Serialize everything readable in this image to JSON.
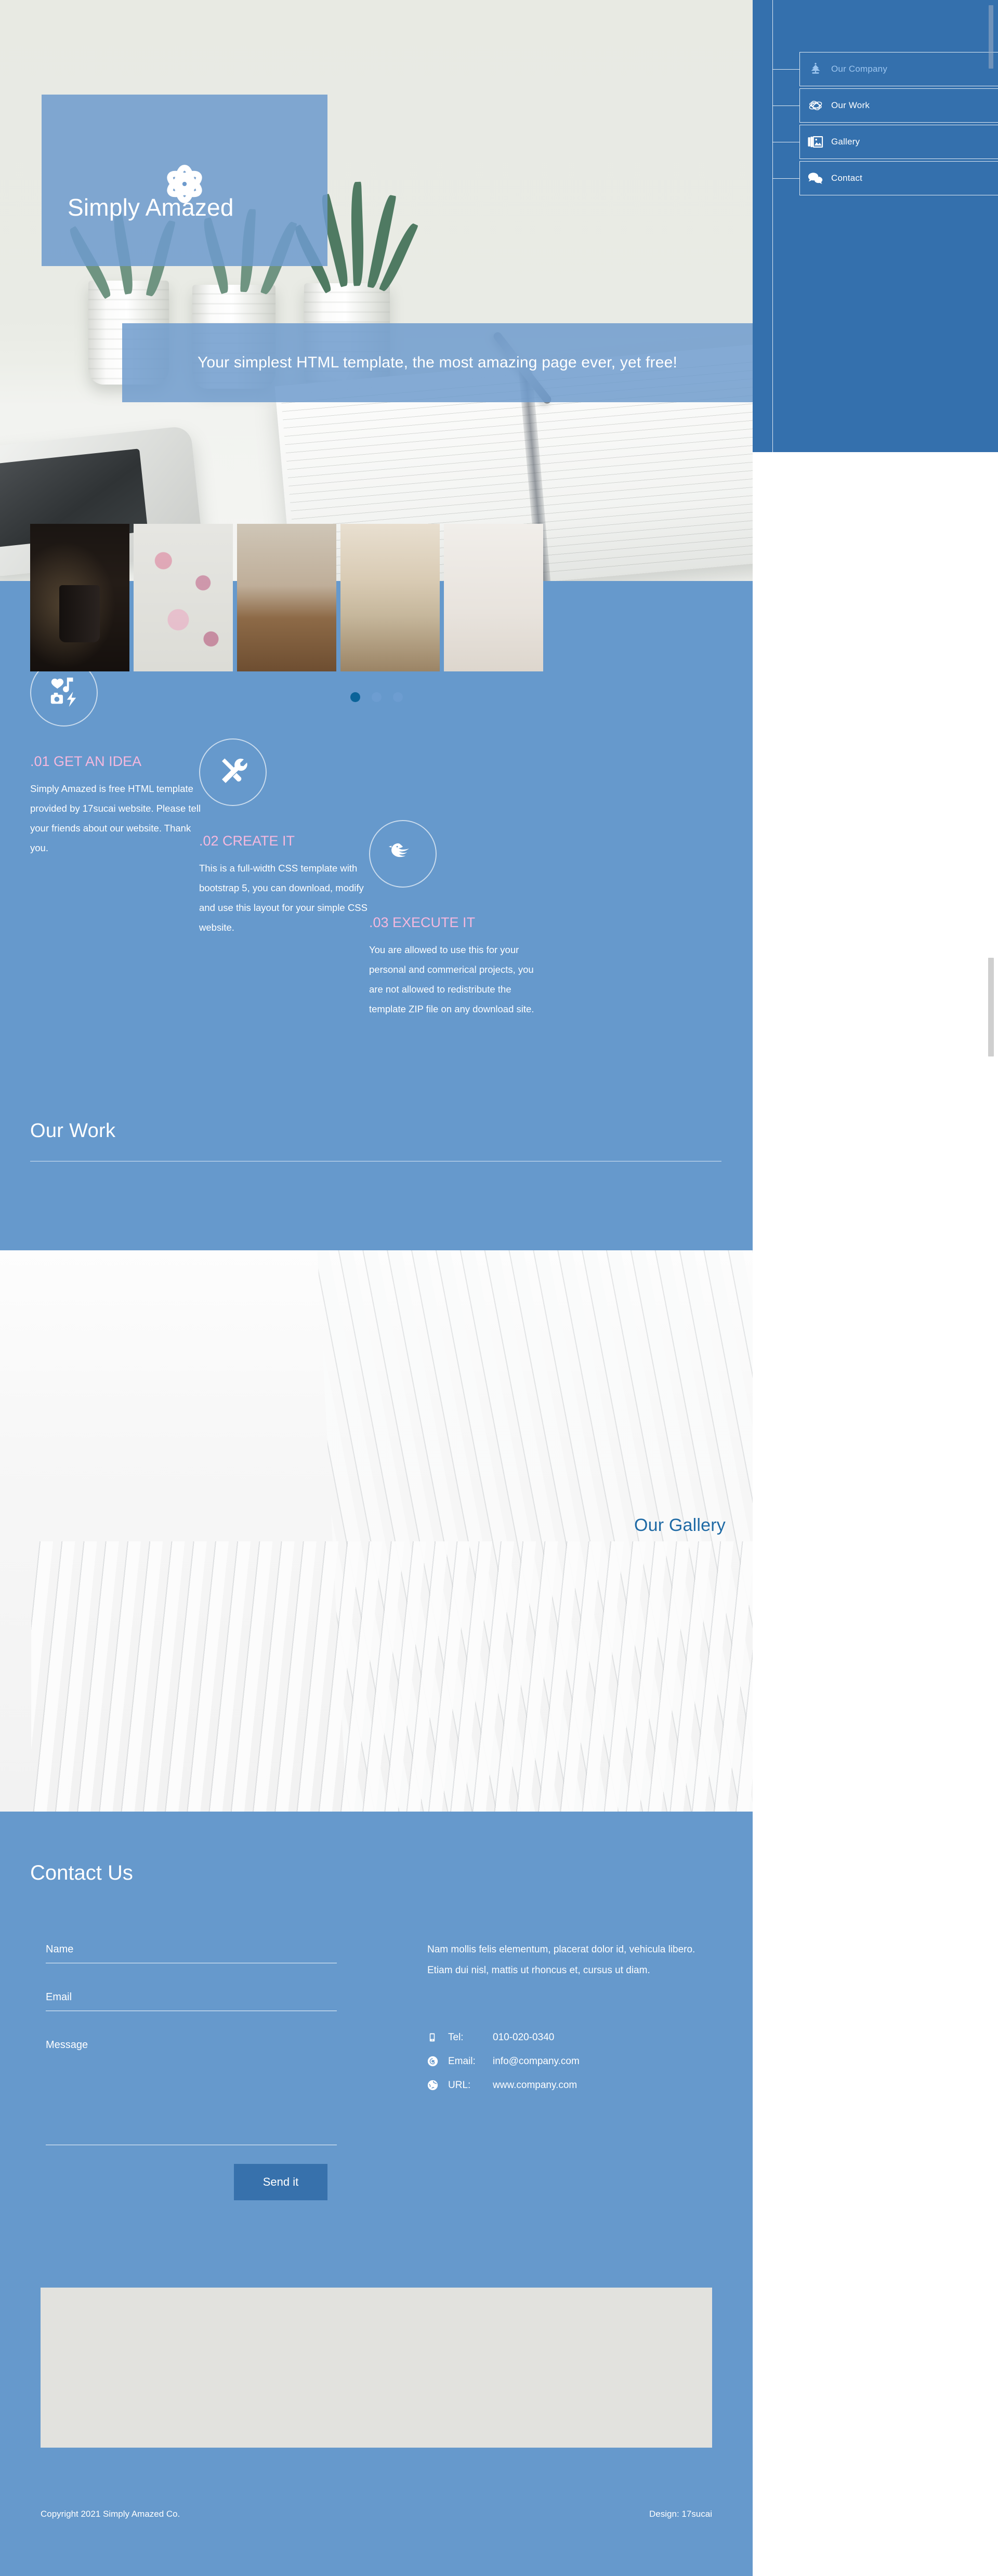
{
  "site": {
    "brand": "Simply Amazed",
    "tagline": "Your simplest HTML template, the most amazing page ever, yet free!"
  },
  "nav": {
    "items": [
      {
        "label": "Our Company",
        "icon": "company-tree-icon",
        "active": true
      },
      {
        "label": "Our Work",
        "icon": "orbit-icon",
        "active": false
      },
      {
        "label": "Gallery",
        "icon": "images-icon",
        "active": false
      },
      {
        "label": "Contact",
        "icon": "chat-bubbles-icon",
        "active": false
      }
    ]
  },
  "features": {
    "items": [
      {
        "title": ".01 GET AN IDEA",
        "icon": "media-mix-icon",
        "text": "Simply Amazed is free HTML template provided by 17sucai website. Please tell your friends about our website. Thank you."
      },
      {
        "title": ".02 CREATE IT",
        "icon": "tools-icon",
        "text": "This is a full-width CSS template with bootstrap 5, you can download, modify and use this layout for your simple CSS website."
      },
      {
        "title": ".03 EXECUTE IT",
        "icon": "bird-icon",
        "text": "You are allowed to use this for your personal and commerical projects, you are not allowed to redistribute the template ZIP file on any download site."
      }
    ],
    "our_work_heading": "Our Work"
  },
  "gallery": {
    "heading": "Our Gallery",
    "slides": [
      {
        "alt": "black mug you can win if you want"
      },
      {
        "alt": "flowers with word tags do love hope peace care live"
      },
      {
        "alt": "laptop on wooden table by window with coffee tray"
      },
      {
        "alt": "open window with laptop on round table"
      },
      {
        "alt": "desk with framed picture wall and plants"
      }
    ],
    "dots": [
      {
        "active": true
      },
      {
        "active": false
      },
      {
        "active": false
      }
    ]
  },
  "contact": {
    "heading": "Contact Us",
    "form": {
      "name_placeholder": "Name",
      "email_placeholder": "Email",
      "message_placeholder": "Message",
      "name_value": "",
      "email_value": "",
      "message_value": "",
      "submit_label": "Send it"
    },
    "lede": "Nam mollis felis elementum, placerat dolor id, vehicula libero. Etiam dui nisl, mattis ut rhoncus et, cursus ut diam.",
    "details": [
      {
        "icon": "mobile-phone-icon",
        "label": "Tel:",
        "value": "010-020-0340"
      },
      {
        "icon": "at-sign-icon",
        "label": "Email:",
        "value": "info@company.com"
      },
      {
        "icon": "globe-icon",
        "label": "URL:",
        "value": "www.company.com"
      }
    ]
  },
  "footer": {
    "copyright": "Copyright 2021 Simply Amazed Co.",
    "design": "Design: 17sucai"
  },
  "colors": {
    "panel_blue": "#3470ad",
    "section_blue": "#6699cc",
    "accent_pink": "#f5b8de",
    "gallery_heading_blue": "#1f6aa5",
    "button_blue": "#3771ac",
    "dot_active": "#0b6399",
    "dot_inactive": "#6d9dd1"
  }
}
